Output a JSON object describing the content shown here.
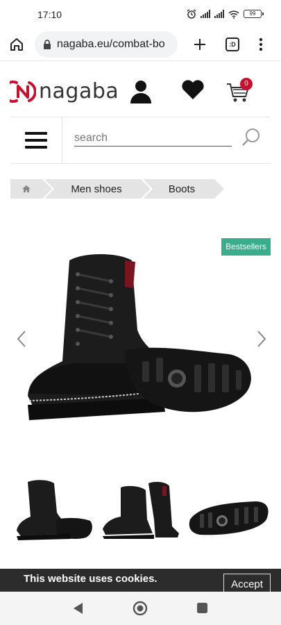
{
  "status_bar": {
    "time": "17:10",
    "battery": "99"
  },
  "browser": {
    "url": "nagaba.eu/combat-bo"
  },
  "site": {
    "logo_text": "nagaba",
    "cart_count": "0",
    "search_placeholder": "search"
  },
  "breadcrumb": {
    "items": [
      "Men shoes",
      "Boots"
    ]
  },
  "product": {
    "badge": "Bestsellers"
  },
  "cookie": {
    "title": "This website uses cookies.",
    "subtitle": "",
    "accept_label": "Accept"
  },
  "colors": {
    "brand_red": "#c8102e",
    "badge_green": "#3aae8c",
    "cookie_bg": "#2c2c2c"
  }
}
